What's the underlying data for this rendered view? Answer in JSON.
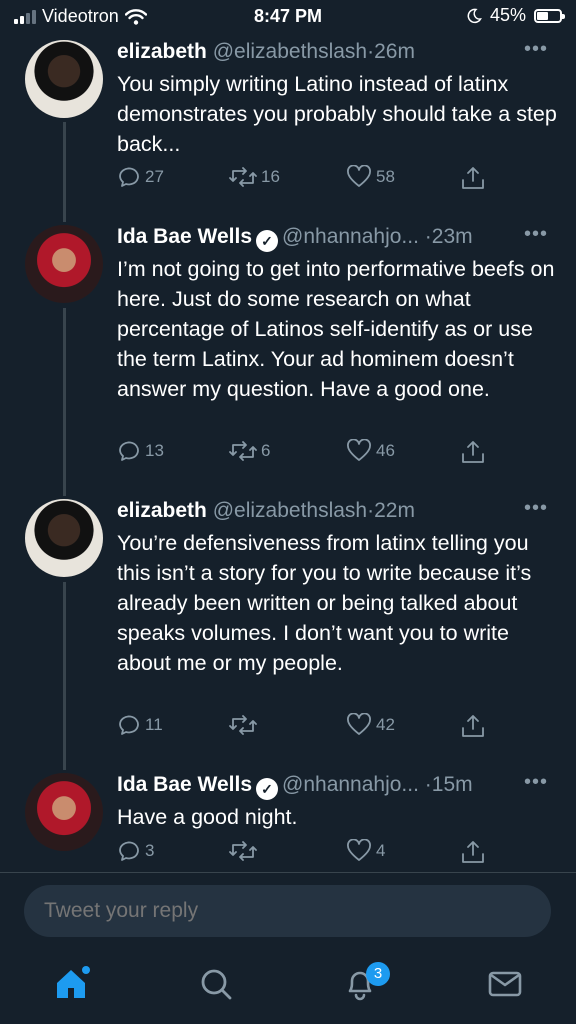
{
  "status_bar": {
    "carrier": "Videotron",
    "time": "8:47 PM",
    "battery": "45%"
  },
  "tweets": [
    {
      "name": "elizabeth",
      "handle": "@elizabethslash",
      "separator": "·",
      "ago": "26m",
      "text": "You simply writing Latino instead of latinx demonstrates you probably should take a step back...",
      "replies": "27",
      "retweets": "16",
      "likes": "58"
    },
    {
      "name": "Ida Bae Wells",
      "handle": "@nhannahjo...",
      "separator": "·",
      "ago": "23m",
      "text": "I’m not going to get into performative beefs on here. Just do some research on what percentage of Latinos self-identify as or use the term Latinx. Your ad hominem doesn’t answer my question. Have a good one.",
      "replies": "13",
      "retweets": "6",
      "likes": "46"
    },
    {
      "name": "elizabeth",
      "handle": "@elizabethslash",
      "separator": "·",
      "ago": "22m",
      "text": "You’re defensiveness from latinx telling you this isn’t a story for you to write because it’s already been written or being talked about speaks volumes. I don’t want you to write about me or my people.",
      "replies": "11",
      "retweets": "",
      "likes": "42"
    },
    {
      "name": "Ida Bae Wells",
      "handle": "@nhannahjo...",
      "separator": "·",
      "ago": "15m",
      "text": "Have a good night.",
      "replies": "3",
      "retweets": "",
      "likes": "4"
    }
  ],
  "composer": {
    "placeholder": "Tweet your reply"
  },
  "tab_bar": {
    "notifications_badge": "3"
  },
  "icons": {
    "status": [
      "signal-icon",
      "wifi-icon",
      "moon-icon",
      "battery-icon"
    ],
    "tweet_actions": [
      "reply-icon",
      "retweet-icon",
      "like-icon",
      "share-icon"
    ],
    "tabs": [
      "home-icon",
      "search-icon",
      "notifications-icon",
      "messages-icon"
    ]
  },
  "colors": {
    "background": "#15202b",
    "secondary_text": "#8899a6",
    "accent": "#1d9bf0"
  }
}
